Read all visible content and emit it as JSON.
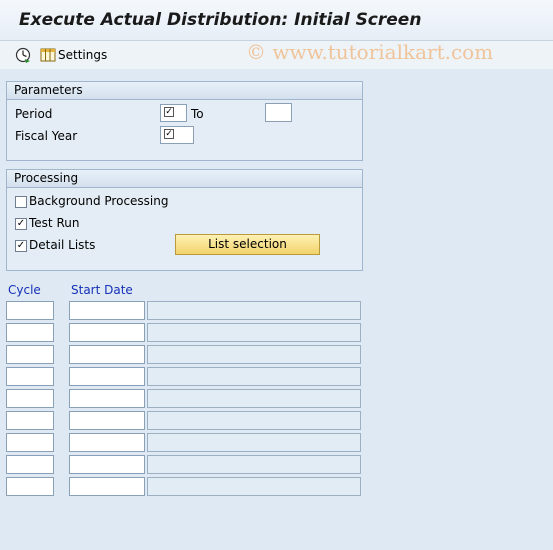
{
  "window": {
    "title": "Execute Actual Distribution: Initial Screen"
  },
  "toolbar": {
    "execute_icon": "execute-clock-icon",
    "settings_icon": "settings-grid-icon",
    "settings_label": "Settings"
  },
  "watermark": "© www.tutorialkart.com",
  "parameters": {
    "header": "Parameters",
    "period_label": "Period",
    "to_label": "To",
    "fiscal_year_label": "Fiscal Year",
    "period_value": "",
    "to_value": "",
    "fiscal_year_value": ""
  },
  "processing": {
    "header": "Processing",
    "background_label": "Background Processing",
    "background_checked": false,
    "test_run_label": "Test Run",
    "test_run_checked": true,
    "detail_lists_label": "Detail Lists",
    "detail_lists_checked": true,
    "list_selection_button": "List selection"
  },
  "table": {
    "col_cycle": "Cycle",
    "col_start_date": "Start Date",
    "row_count": 9
  },
  "colors": {
    "accent_blue": "#1530b8",
    "button_yellow": "#f2d36a",
    "watermark": "#f0c49a"
  }
}
